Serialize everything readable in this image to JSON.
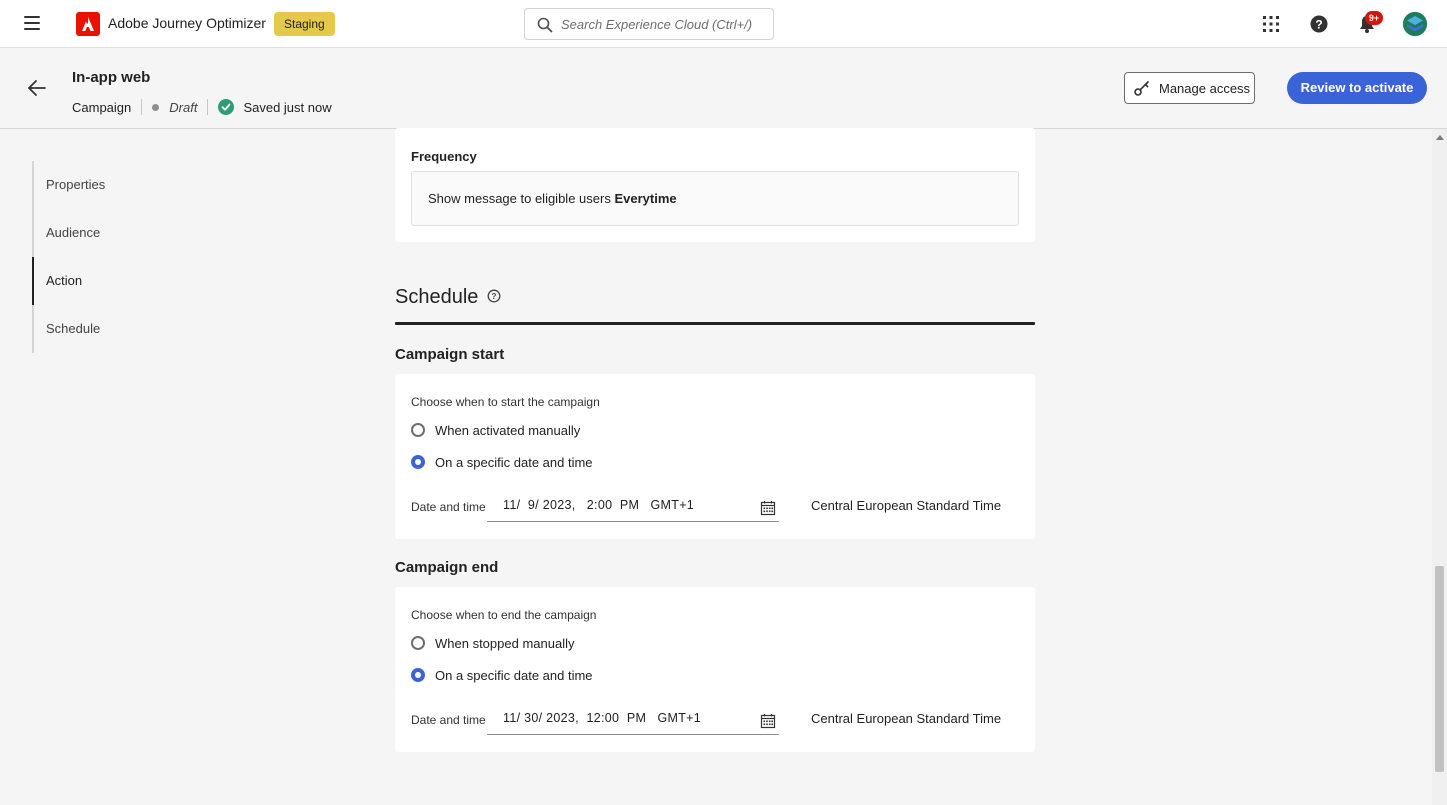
{
  "shell": {
    "app_name": "Adobe Journey Optimizer",
    "environment": "Staging",
    "search_placeholder": "Search Experience Cloud (Ctrl+/)",
    "notification_count": "9+"
  },
  "header": {
    "title": "In-app web",
    "type": "Campaign",
    "status": "Draft",
    "save_status": "Saved just now",
    "manage_access_label": "Manage access",
    "review_label": "Review to activate"
  },
  "nav": {
    "items": [
      {
        "label": "Properties",
        "active": false
      },
      {
        "label": "Audience",
        "active": false
      },
      {
        "label": "Action",
        "active": true
      },
      {
        "label": "Schedule",
        "active": false
      }
    ]
  },
  "frequency": {
    "label": "Frequency",
    "text_prefix": "Show message to eligible users",
    "value": "Everytime"
  },
  "schedule": {
    "title": "Schedule",
    "start": {
      "title": "Campaign start",
      "choose_label": "Choose when to start the campaign",
      "options": [
        {
          "label": "When activated manually",
          "checked": false
        },
        {
          "label": "On a specific date and time",
          "checked": true
        }
      ],
      "date_label": "Date and time",
      "date_value": "11/  9/ 2023,   2:00  PM   GMT+1",
      "timezone": "Central European Standard Time"
    },
    "end": {
      "title": "Campaign end",
      "choose_label": "Choose when to end the campaign",
      "options": [
        {
          "label": "When stopped manually",
          "checked": false
        },
        {
          "label": "On a specific date and time",
          "checked": true
        }
      ],
      "date_label": "Date and time",
      "date_value": "11/ 30/ 2023,  12:00  PM   GMT+1",
      "timezone": "Central European Standard Time"
    }
  },
  "colors": {
    "accent": "#3b63d8",
    "brand_red": "#eb1000",
    "staging_badge": "#e6c84a",
    "saved_green": "#2d9d78"
  }
}
